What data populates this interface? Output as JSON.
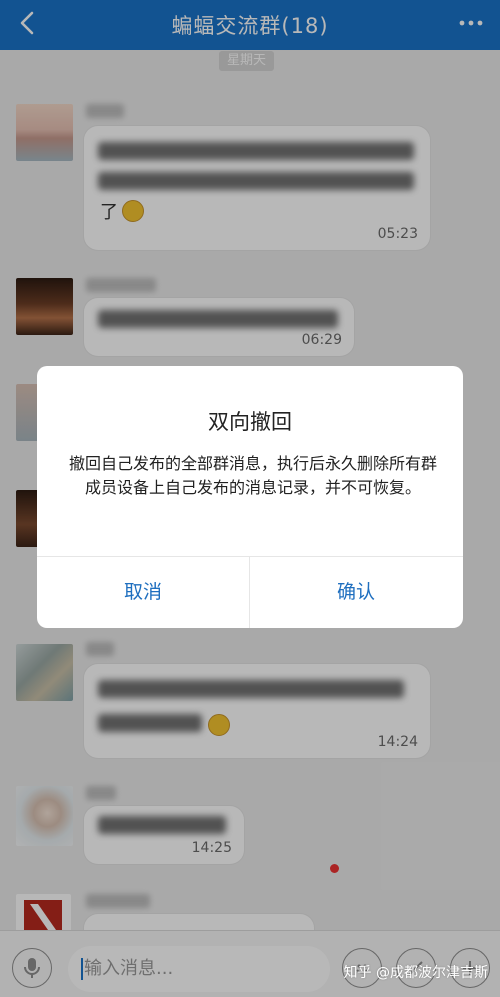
{
  "header": {
    "title": "蝙蝠交流群(18)",
    "back_icon": "chevron-left-icon",
    "more_icon": "more-dots-icon"
  },
  "chat": {
    "date_label": "星期天",
    "messages": [
      {
        "text_visible": "了",
        "time": "05:23"
      },
      {
        "time": "06:29"
      },
      {
        "text_visible": "",
        "time": "14:24"
      },
      {
        "time": "14:25"
      }
    ]
  },
  "dialog": {
    "title": "双向撤回",
    "body": "撤回自己发布的全部群消息，执行后永久删除所有群成员设备上自己发布的消息记录，并不可恢复。",
    "cancel_label": "取消",
    "confirm_label": "确认"
  },
  "input": {
    "placeholder": "输入消息..."
  },
  "watermark": "知乎 @成都波尔津吉斯",
  "colors": {
    "header": "#1a73c9",
    "dialog_button": "#1f6fbf",
    "overlay": "rgba(0,0,0,0.28)"
  }
}
